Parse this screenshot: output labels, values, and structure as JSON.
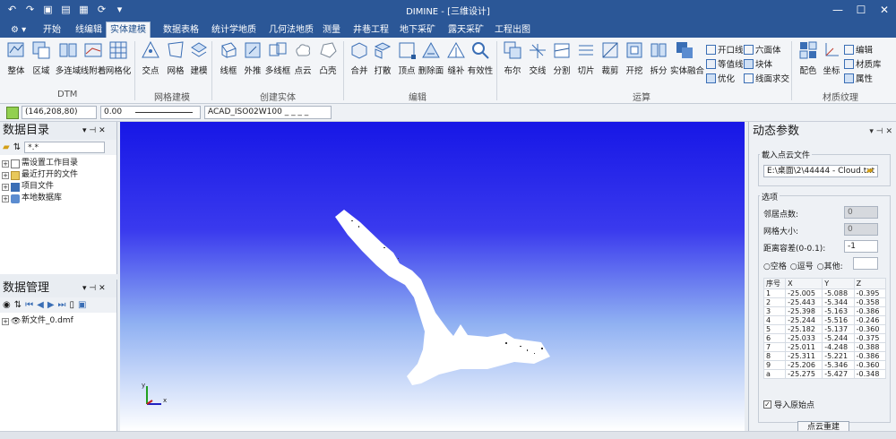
{
  "app": {
    "title": "DIMINE - [三维设计]"
  },
  "quick_access": [
    "undo-icon",
    "redo-icon",
    "save-icon",
    "new-icon",
    "save-all-icon",
    "refresh-icon",
    "dropdown-icon"
  ],
  "tabs": [
    "开始",
    "线编辑",
    "实体建模",
    "数据表格",
    "统计学地质",
    "几何法地质",
    "测量",
    "井巷工程",
    "地下采矿",
    "露天采矿",
    "工程出图"
  ],
  "active_tab": "实体建模",
  "ribbon": {
    "groups": {
      "dtm": "DTM",
      "mesh": "网格建模",
      "solid": "创建实体",
      "edit": "编辑",
      "ops": "运算",
      "material": "材质纹理"
    },
    "dtm": [
      "整体",
      "区域",
      "多连域",
      "线附着",
      "网格化"
    ],
    "mesh": [
      "交点",
      "网格",
      "建模"
    ],
    "solid": [
      "线框",
      "外推",
      "多线框",
      "点云",
      "凸壳"
    ],
    "edit": [
      "合并",
      "打散",
      "顶点",
      "删除面",
      "缝补",
      "有效性"
    ],
    "ops": [
      "布尔",
      "交线",
      "分割",
      "切片",
      "裁剪",
      "开挖",
      "拆分",
      "实体融合"
    ],
    "ops_small": [
      "开口线",
      "等值线",
      "优化",
      "六面体",
      "块体",
      "线面求交"
    ],
    "material": [
      "配色",
      "坐标"
    ],
    "material_small": [
      "编辑",
      "材质库",
      "属性"
    ]
  },
  "propbar": {
    "color": "(146,208,80)",
    "width": "0.00",
    "linetype": "ACAD_ISO02W100 _ _ _ _"
  },
  "colors": {
    "layer_color": "#92d050",
    "title_bg": "#2b5797",
    "point_cloud": "#ffffff"
  },
  "data_catalog": {
    "title": "数据目录",
    "filter": "*.*",
    "items": [
      "需设置工作目录",
      "最近打开的文件",
      "项目文件",
      "本地数据库"
    ]
  },
  "data_manager": {
    "title": "数据管理",
    "items": [
      "新文件_0.dmf"
    ]
  },
  "right_panel": {
    "title": "动态参数",
    "load_group": "載入点云文件",
    "file_path": "E:\\桌面\\2\\44444 - Cloud.txt",
    "options_group": "选项",
    "neighbor_label": "邻居点数:",
    "neighbor_value": "0",
    "mesh_label": "网格大小:",
    "mesh_value": "0",
    "dist_label": "距离容差(0-0.1):",
    "dist_value": "-1",
    "radio": [
      "空格",
      "逗号",
      "其他:"
    ],
    "columns": [
      "序号",
      "X",
      "Y",
      "Z"
    ],
    "rows": [
      [
        "1",
        "-25.005",
        "-5.088",
        "-0.395"
      ],
      [
        "2",
        "-25.443",
        "-5.344",
        "-0.358"
      ],
      [
        "3",
        "-25.398",
        "-5.163",
        "-0.386"
      ],
      [
        "4",
        "-25.244",
        "-5.516",
        "-0.246"
      ],
      [
        "5",
        "-25.182",
        "-5.137",
        "-0.360"
      ],
      [
        "6",
        "-25.033",
        "-5.244",
        "-0.375"
      ],
      [
        "7",
        "-25.011",
        "-4.248",
        "-0.388"
      ],
      [
        "8",
        "-25.311",
        "-5.221",
        "-0.386"
      ],
      [
        "9",
        "-25.206",
        "-5.346",
        "-0.360"
      ],
      [
        "a",
        "-25.275",
        "-5.427",
        "-0.348"
      ]
    ],
    "import_checkbox": "导入原始点",
    "rebuild_button": "点云重建"
  },
  "axes": {
    "y": "y",
    "x": "x"
  }
}
